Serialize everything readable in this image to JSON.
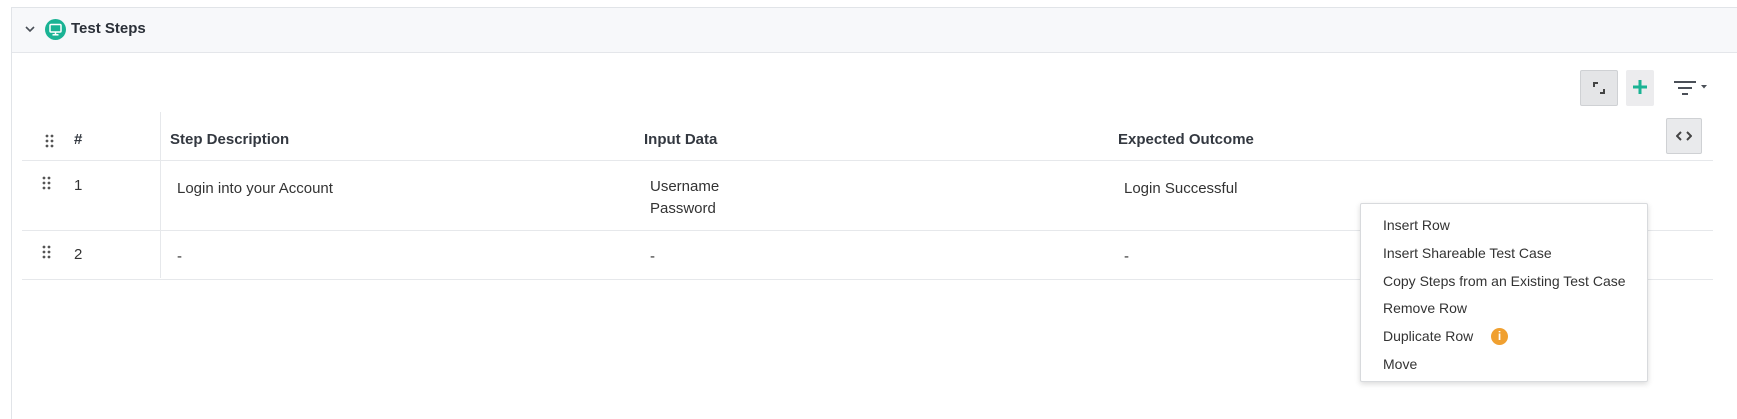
{
  "section": {
    "title": "Test Steps",
    "collapse_icon": "chevron-down-icon",
    "section_icon": "monitor-icon",
    "accent_color": "#1ab394"
  },
  "toolbar": {
    "expand_icon": "expand-icon",
    "add_icon": "plus-icon",
    "filter_icon": "filter-icon"
  },
  "table": {
    "columns": [
      "#",
      "Step Description",
      "Input Data",
      "Expected Outcome"
    ],
    "rows": [
      {
        "num": "1",
        "description": "Login into your Account",
        "input_line1": "Username",
        "input_line2": "Password",
        "expected": "Login Successful"
      },
      {
        "num": "2",
        "description": "-",
        "input_line1": "-",
        "input_line2": "",
        "expected": "-"
      }
    ]
  },
  "context_menu": {
    "items": [
      "Insert Row",
      "Insert Shareable Test Case",
      "Copy Steps from an Existing Test Case",
      "Remove Row",
      "Duplicate Row",
      "Move"
    ],
    "info_glyph": "i",
    "info_color": "#f0a030"
  }
}
